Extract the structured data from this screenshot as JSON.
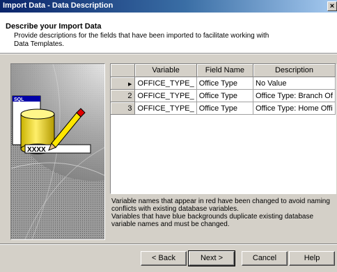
{
  "window": {
    "title": "Import Data - Data Description",
    "close_glyph": "×"
  },
  "header": {
    "title": "Describe your Import Data",
    "description": "Provide descriptions for the fields that have been imported to facilitate working with Data Templates."
  },
  "illustration": {
    "sql_label": "SQL",
    "field_text": "XXXX"
  },
  "grid": {
    "columns": [
      "Variable",
      "Field Name",
      "Description"
    ],
    "rows": [
      {
        "num": "",
        "variable": "OFFICE_TYPE_",
        "field_name": "Office Type",
        "description": "No Value"
      },
      {
        "num": "2",
        "variable": "OFFICE_TYPE_",
        "field_name": "Office Type",
        "description": "Office Type: Branch Of"
      },
      {
        "num": "3",
        "variable": "OFFICE_TYPE_",
        "field_name": "Office Type",
        "description": "Office Type: Home Offi"
      }
    ],
    "current_row_glyph": "▶"
  },
  "notes": {
    "red": "Variable names that appear in red have been changed to avoid naming conflicts with existing database variables.",
    "blue": "Variables that have blue backgrounds duplicate existing database variable names and must be changed."
  },
  "buttons": {
    "back": "< Back",
    "next": "Next >",
    "cancel": "Cancel",
    "help": "Help"
  }
}
